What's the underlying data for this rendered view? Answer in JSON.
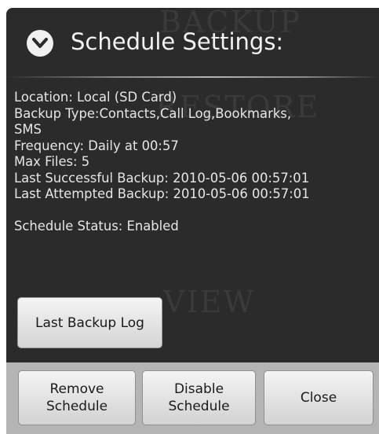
{
  "dialog": {
    "title": "Schedule Settings:",
    "title_icon": "chevron-down-circle-icon",
    "background_ghost_text": [
      "BACKUP",
      "RESTORE",
      "VIEW"
    ],
    "message_lines": [
      "Location: Local (SD Card)",
      "Backup Type:Contacts,Call Log,Bookmarks,",
      "SMS",
      "Frequency: Daily at 00:57",
      "Max Files: 5",
      "Last Successful Backup: 2010-05-06 00:57:01",
      "Last Attempted Backup: 2010-05-06 00:57:01",
      "",
      "Schedule Status: Enabled"
    ],
    "log_button": "Last Backup Log"
  },
  "footer": {
    "remove_line1": "Remove",
    "remove_line2": "Schedule",
    "disable_line1": "Disable",
    "disable_line2": "Schedule",
    "close": "Close"
  },
  "colors": {
    "dialog_bg": "#2b2b2b",
    "text": "#e6e6e6",
    "footer_bg": "#b4b4b4"
  }
}
